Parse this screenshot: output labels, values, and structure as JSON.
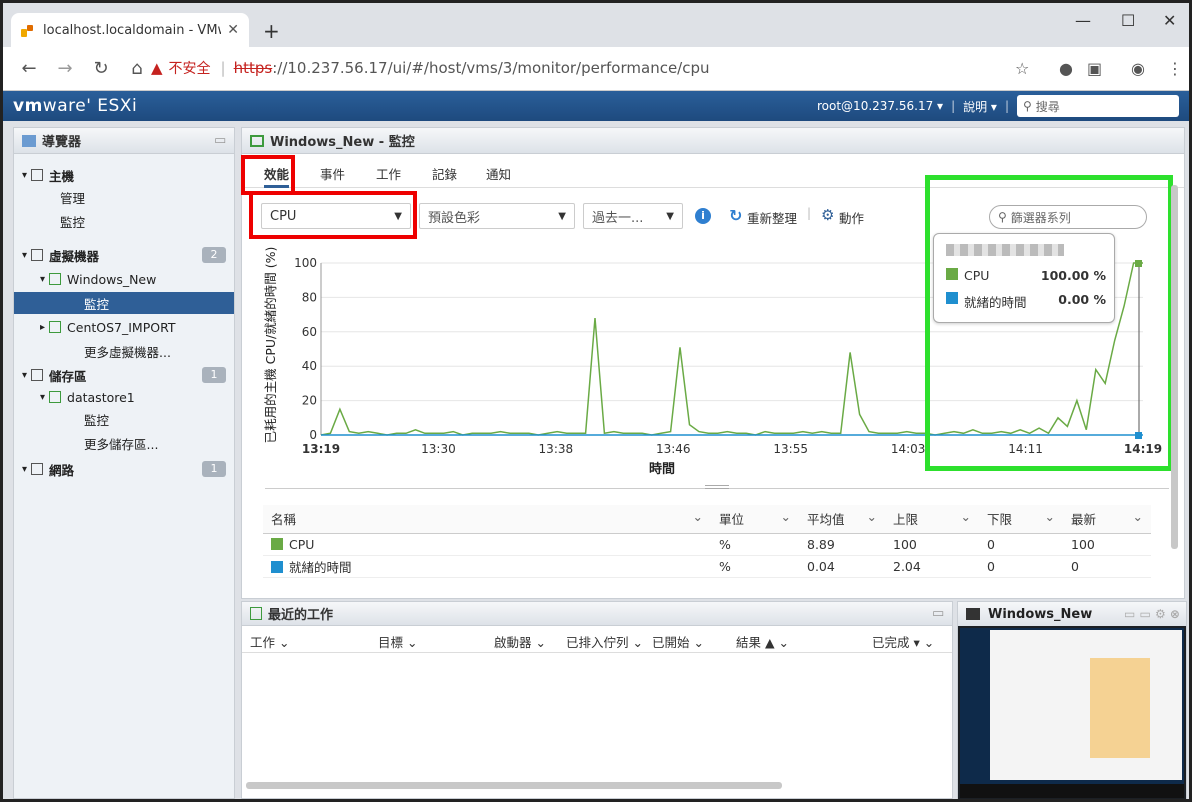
{
  "browser": {
    "tab_title": "localhost.localdomain - VMwar",
    "new_tab": "+",
    "url_warning": "不安全",
    "url_scheme": "https",
    "url_rest": "://10.237.56.17/ui/#/host/vms/3/monitor/performance/cpu",
    "controls": {
      "minimize": "—",
      "maximize": "☐",
      "close": "✕"
    }
  },
  "header": {
    "logo_vm": "vm",
    "logo_rest": "ware' ESXi",
    "user": "root@10.237.56.17 ▾",
    "help": "說明 ▾",
    "search_placeholder": "搜尋"
  },
  "navigator": {
    "title": "導覽器",
    "items": [
      {
        "label": "主機",
        "indent": 0
      },
      {
        "label": "管理",
        "indent": 1
      },
      {
        "label": "監控",
        "indent": 1
      },
      {
        "label": "虛擬機器",
        "indent": 0,
        "badge": "2"
      },
      {
        "label": "Windows_New",
        "indent": 1
      },
      {
        "label": "監控",
        "indent": 2,
        "selected": true
      },
      {
        "label": "CentOS7_IMPORT",
        "indent": 1
      },
      {
        "label": "更多虛擬機器...",
        "indent": 2
      },
      {
        "label": "儲存區",
        "indent": 0,
        "badge": "1"
      },
      {
        "label": "datastore1",
        "indent": 1
      },
      {
        "label": "監控",
        "indent": 2
      },
      {
        "label": "更多儲存區...",
        "indent": 2
      },
      {
        "label": "網路",
        "indent": 0,
        "badge": "1"
      }
    ]
  },
  "main": {
    "title": "Windows_New - 監控",
    "tabs": [
      "效能",
      "事件",
      "工作",
      "記錄",
      "通知"
    ],
    "metric_select": "CPU",
    "color_select": "預設色彩",
    "time_select": "過去一...",
    "refresh": "重新整理",
    "actions": "動作",
    "filter_placeholder": "篩選器系列"
  },
  "legend": {
    "rows": [
      {
        "name": "CPU",
        "value": "100.00 %",
        "color": "#6aaa45"
      },
      {
        "name": "就緒的時間",
        "value": "0.00 %",
        "color": "#1f8fcf"
      }
    ]
  },
  "chart_data": {
    "type": "line",
    "ylabel": "已耗用的主機 CPU/就緒的時間 (%)",
    "xlabel": "時間",
    "ylim": [
      0,
      100
    ],
    "yticks": [
      0,
      20,
      40,
      60,
      80,
      100
    ],
    "xticks": [
      "13:19",
      "13:30",
      "13:38",
      "13:46",
      "13:55",
      "14:03",
      "14:11",
      "14:19"
    ],
    "series": [
      {
        "name": "CPU",
        "color": "#6aaa45",
        "values": [
          0,
          1,
          15,
          2,
          1,
          2,
          1,
          0,
          1,
          1,
          3,
          1,
          1,
          1,
          2,
          0,
          1,
          1,
          1,
          2,
          1,
          1,
          1,
          0,
          1,
          2,
          1,
          1,
          1,
          68,
          1,
          2,
          1,
          1,
          1,
          0,
          1,
          2,
          51,
          6,
          2,
          1,
          1,
          2,
          1,
          1,
          0,
          2,
          1,
          1,
          1,
          2,
          1,
          2,
          1,
          1,
          48,
          12,
          2,
          1,
          1,
          1,
          2,
          1,
          1,
          0,
          1,
          2,
          1,
          3,
          1,
          1,
          2,
          1,
          3,
          1,
          4,
          1,
          10,
          5,
          20,
          3,
          38,
          30,
          55,
          75,
          100,
          100
        ]
      },
      {
        "name": "就緒的時間",
        "color": "#1f8fcf",
        "values": [
          0,
          0,
          0,
          0,
          0,
          0,
          0,
          0,
          0,
          0,
          0,
          0,
          0,
          0,
          0,
          0,
          0,
          0,
          0,
          0,
          0,
          0,
          0,
          0,
          0,
          0,
          0,
          0,
          0,
          0,
          0,
          0,
          0,
          0,
          0,
          0,
          0,
          0,
          0,
          0,
          0,
          0,
          0,
          0,
          0,
          0,
          0,
          0,
          0,
          0,
          0,
          0,
          0,
          0,
          0,
          0,
          0,
          0,
          0,
          0,
          0,
          0,
          0,
          0,
          0,
          0,
          0,
          0,
          0,
          0,
          0,
          0,
          0,
          0,
          0,
          0,
          0,
          0,
          0,
          0,
          0,
          0,
          0,
          0,
          0,
          0,
          0,
          0
        ]
      }
    ]
  },
  "table": {
    "headers": [
      "名稱",
      "單位",
      "平均值",
      "上限",
      "下限",
      "最新"
    ],
    "rows": [
      {
        "name": "CPU",
        "color": "#6aaa45",
        "unit": "%",
        "avg": "8.89",
        "max": "100",
        "min": "0",
        "latest": "100"
      },
      {
        "name": "就緒的時間",
        "color": "#1f8fcf",
        "unit": "%",
        "avg": "0.04",
        "max": "2.04",
        "min": "0",
        "latest": "0"
      }
    ]
  },
  "tasks": {
    "title": "最近的工作",
    "columns": [
      "工作",
      "目標",
      "啟動器",
      "已排入佇列",
      "已開始",
      "結果 ▲",
      "已完成 ▾"
    ]
  },
  "thumbnail": {
    "title": "Windows_New"
  }
}
